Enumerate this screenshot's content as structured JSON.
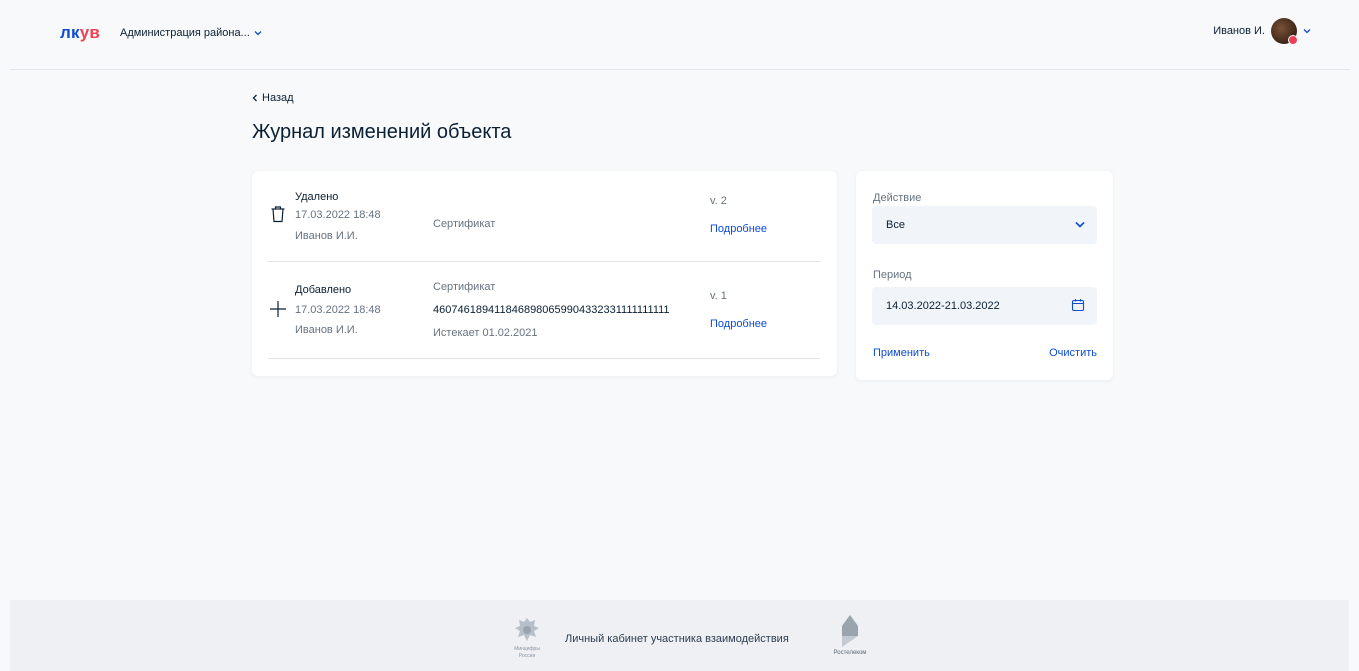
{
  "header": {
    "logo_part1": "лк",
    "logo_part2": "ув",
    "org_name": "Администрация района...",
    "user_name": "Иванов И."
  },
  "nav": {
    "back_label": "Назад"
  },
  "page": {
    "title": "Журнал изменений объекта"
  },
  "log": {
    "entries": [
      {
        "icon": "trash-icon",
        "action": "Удалено",
        "datetime": "17.03.2022 18:48",
        "author": "Иванов И.И.",
        "object": "Сертификат",
        "version": "v. 2",
        "details_label": "Подробнее"
      },
      {
        "icon": "plus-icon",
        "action": "Добавлено",
        "datetime": "17.03.2022 18:48",
        "author": "Иванов И.И.",
        "object": "Сертификат",
        "number": "4607461894118468980659904332331111111111",
        "expires": "Истекает 01.02.2021",
        "version": "v. 1",
        "details_label": "Подробнее"
      }
    ]
  },
  "filter": {
    "action_label": "Действие",
    "action_value": "Все",
    "period_label": "Период",
    "period_value": "14.03.2022-21.03.2022",
    "apply_label": "Применить",
    "clear_label": "Очистить"
  },
  "footer": {
    "text": "Личный кабинет участника взаимодействия",
    "ministry_caption_1": "Минцифры",
    "ministry_caption_2": "России",
    "partner_caption": "Ростелеком"
  },
  "colors": {
    "accent": "#0d4cd3",
    "logo_red": "#ee3f58",
    "text": "#0b1f33",
    "muted": "#66727f"
  }
}
